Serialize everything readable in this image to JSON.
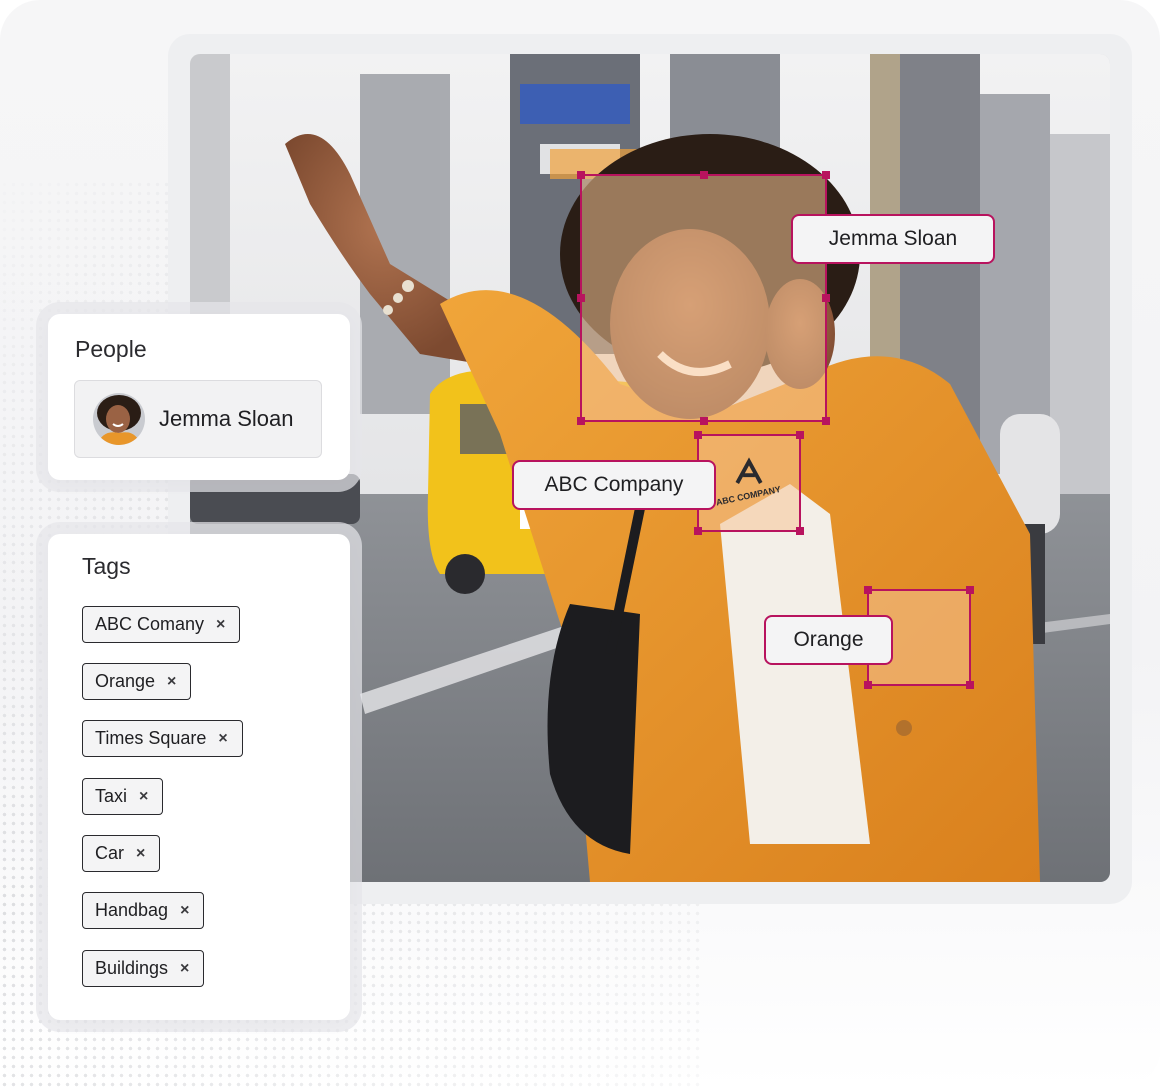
{
  "people_card": {
    "title": "People",
    "person": {
      "name": "Jemma Sloan",
      "avatar_icon": "avatar-photo"
    }
  },
  "tags_card": {
    "title": "Tags",
    "tags": [
      {
        "label": "ABC Comany",
        "remove_icon": "×"
      },
      {
        "label": "Orange",
        "remove_icon": "×"
      },
      {
        "label": "Times Square",
        "remove_icon": "×"
      },
      {
        "label": "Taxi",
        "remove_icon": "×"
      },
      {
        "label": "Car",
        "remove_icon": "×"
      },
      {
        "label": "Handbag",
        "remove_icon": "×"
      },
      {
        "label": "Buildings",
        "remove_icon": "×"
      }
    ]
  },
  "detections": [
    {
      "label": "Jemma Sloan"
    },
    {
      "label": "ABC Company",
      "logo_text": "ABC COMPANY"
    },
    {
      "label": "Orange"
    }
  ],
  "colors": {
    "accent": "#b8135e",
    "jacket": "#e8962a",
    "taxi": "#f2c21b"
  }
}
